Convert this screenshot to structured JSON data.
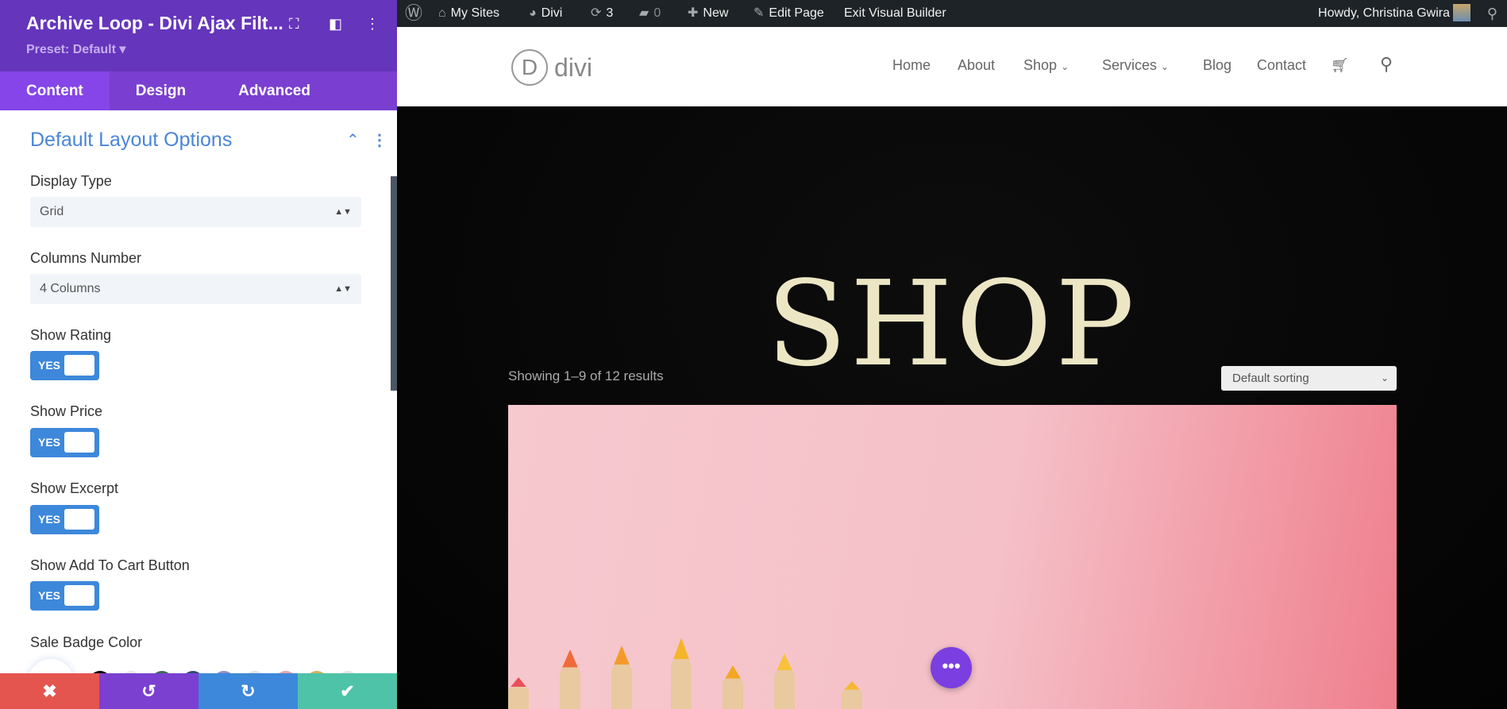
{
  "sidebar": {
    "title": "Archive Loop - Divi Ajax Filt...",
    "preset": "Preset: Default ▾",
    "tabs": [
      {
        "label": "Content"
      },
      {
        "label": "Design"
      },
      {
        "label": "Advanced"
      }
    ],
    "section_title": "Default Layout Options",
    "display_type": {
      "label": "Display Type",
      "value": "Grid"
    },
    "columns": {
      "label": "Columns Number",
      "value": "4 Columns"
    },
    "toggles": [
      {
        "label": "Show Rating",
        "value": "YES"
      },
      {
        "label": "Show Price",
        "value": "YES"
      },
      {
        "label": "Show Excerpt",
        "value": "YES"
      },
      {
        "label": "Show Add To Cart Button",
        "value": "YES"
      }
    ],
    "sale_badge_label": "Sale Badge Color",
    "swatches": [
      "#000000",
      "#e8e8e8",
      "#3d6b57",
      "#2e4a7a",
      "#8f8fc9",
      "#e3e3e3",
      "#e6a5a5",
      "#d9b15e",
      "#e5e5e5"
    ],
    "footer": {
      "colors": [
        "#e5554f",
        "#7b40d0",
        "#3d88da",
        "#4ec3a7"
      ]
    }
  },
  "adminbar": {
    "my_sites": "My Sites",
    "divi": "Divi",
    "updates": "3",
    "comments": "0",
    "new": "New",
    "edit_page": "Edit Page",
    "exit_vb": "Exit Visual Builder",
    "howdy": "Howdy, Christina Gwira"
  },
  "header": {
    "logo": "divi",
    "logo_letter": "D",
    "nav": [
      "Home",
      "About",
      "Shop",
      "Services",
      "Blog",
      "Contact"
    ]
  },
  "hero": {
    "title": "SHOP",
    "showing": "Showing 1–9 of 12 results",
    "sort": "Default sorting"
  }
}
